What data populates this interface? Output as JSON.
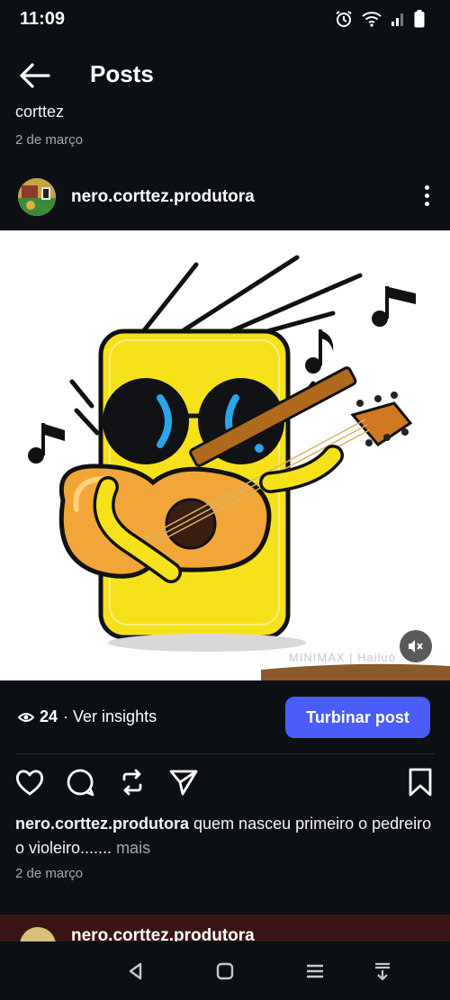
{
  "status": {
    "time": "11:09"
  },
  "header": {
    "title": "Posts"
  },
  "previous_post": {
    "caption_tail": "corttez",
    "date": "2 de março"
  },
  "post": {
    "username": "nero.corttez.produtora",
    "media": {
      "watermark": "MINIMAX | Hailuo",
      "muted": true
    },
    "views": "24",
    "insights_label": "· Ver insights",
    "boost_label": "Turbinar post",
    "caption_user": "nero.corttez.produtora",
    "caption_text": "quem nasceu primeiro o pedreiro o violeiro.......",
    "caption_more": "mais",
    "date": "2 de março",
    "actions": [
      "heart-icon",
      "comment-icon",
      "repost-icon",
      "share-icon",
      "bookmark-icon"
    ]
  },
  "next_post": {
    "username": "nero.corttez.produtora"
  },
  "colors": {
    "background": "#0c1014",
    "accent": "#4a5df9",
    "secondary_text": "#a8a8a8"
  }
}
